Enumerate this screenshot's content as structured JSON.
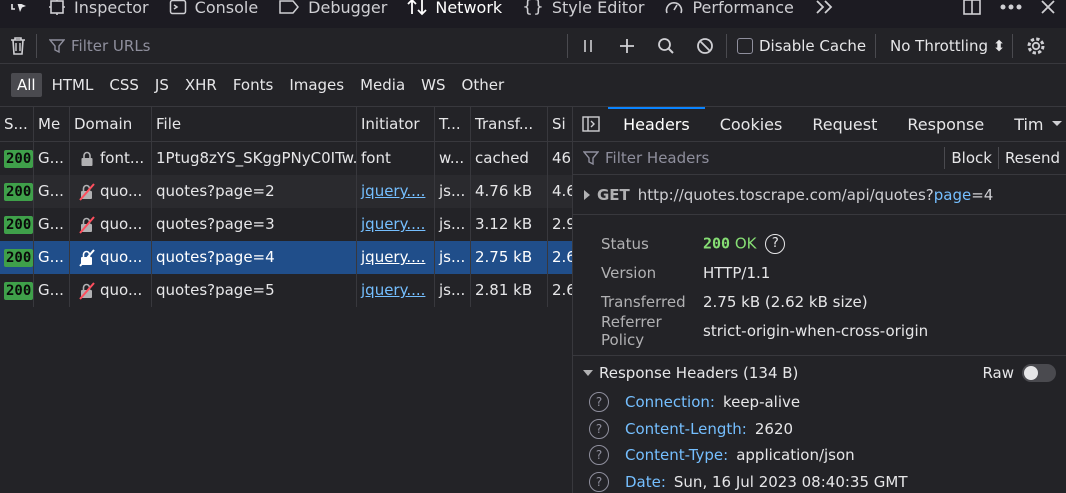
{
  "toolbox": {
    "tabs": [
      {
        "label": "Inspector",
        "icon": "inspector-icon"
      },
      {
        "label": "Console",
        "icon": "console-icon"
      },
      {
        "label": "Debugger",
        "icon": "debugger-icon"
      },
      {
        "label": "Network",
        "icon": "network-icon",
        "active": true
      },
      {
        "label": "Style Editor",
        "icon": "style-editor-icon"
      },
      {
        "label": "Performance",
        "icon": "performance-icon"
      }
    ]
  },
  "toolbar": {
    "filter_placeholder": "Filter URLs",
    "disable_cache_label": "Disable Cache",
    "throttling_label": "No Throttling ⬍"
  },
  "type_filters": [
    "All",
    "HTML",
    "CSS",
    "JS",
    "XHR",
    "Fonts",
    "Images",
    "Media",
    "WS",
    "Other"
  ],
  "table": {
    "columns": [
      "S...",
      "Me",
      "Domain",
      "File",
      "Initiator",
      "T...",
      "Transf...",
      "Si"
    ],
    "rows": [
      {
        "status": "200",
        "method": "G...",
        "domain": "font...",
        "file": "1Ptug8zYS_SKggPNyC0ITw.w",
        "initiator": "font",
        "type": "w...",
        "transferred": "cached",
        "size": "46"
      },
      {
        "status": "200",
        "method": "G...",
        "domain": "quo...",
        "file": "quotes?page=2",
        "initiator": "jquery....",
        "type": "js...",
        "transferred": "4.76 kB",
        "size": "4.6"
      },
      {
        "status": "200",
        "method": "G...",
        "domain": "quo...",
        "file": "quotes?page=3",
        "initiator": "jquery....",
        "type": "js...",
        "transferred": "3.12 kB",
        "size": "2.9"
      },
      {
        "status": "200",
        "method": "G...",
        "domain": "quo...",
        "file": "quotes?page=4",
        "initiator": "jquery....",
        "type": "js...",
        "transferred": "2.75 kB",
        "size": "2.6"
      },
      {
        "status": "200",
        "method": "G...",
        "domain": "quo...",
        "file": "quotes?page=5",
        "initiator": "jquery....",
        "type": "js...",
        "transferred": "2.81 kB",
        "size": "2.6"
      }
    ]
  },
  "panel": {
    "tabs": [
      "Headers",
      "Cookies",
      "Request",
      "Response",
      "Tim"
    ],
    "filter_placeholder": "Filter Headers",
    "block_label": "Block",
    "resend_label": "Resend",
    "request": {
      "method": "GET",
      "url_base": "http://quotes.toscrape.com/api/quotes?",
      "param_key": "page",
      "param_rest": "=4"
    },
    "summary": [
      {
        "key": "Status",
        "value": "200"
      },
      {
        "key": "Version",
        "value": "HTTP/1.1"
      },
      {
        "key": "Transferred",
        "value": "2.75 kB (2.62 kB size)"
      },
      {
        "key": "Referrer Policy",
        "value": "strict-origin-when-cross-origin"
      }
    ],
    "status_text": "OK",
    "response_headers_label": "Response Headers (134 B)",
    "raw_label": "Raw",
    "response_headers": [
      {
        "name": "Connection:",
        "value": "keep-alive"
      },
      {
        "name": "Content-Length:",
        "value": "2620"
      },
      {
        "name": "Content-Type:",
        "value": "application/json"
      },
      {
        "name": "Date:",
        "value": "Sun, 16 Jul 2023 08:40:35 GMT"
      }
    ]
  }
}
